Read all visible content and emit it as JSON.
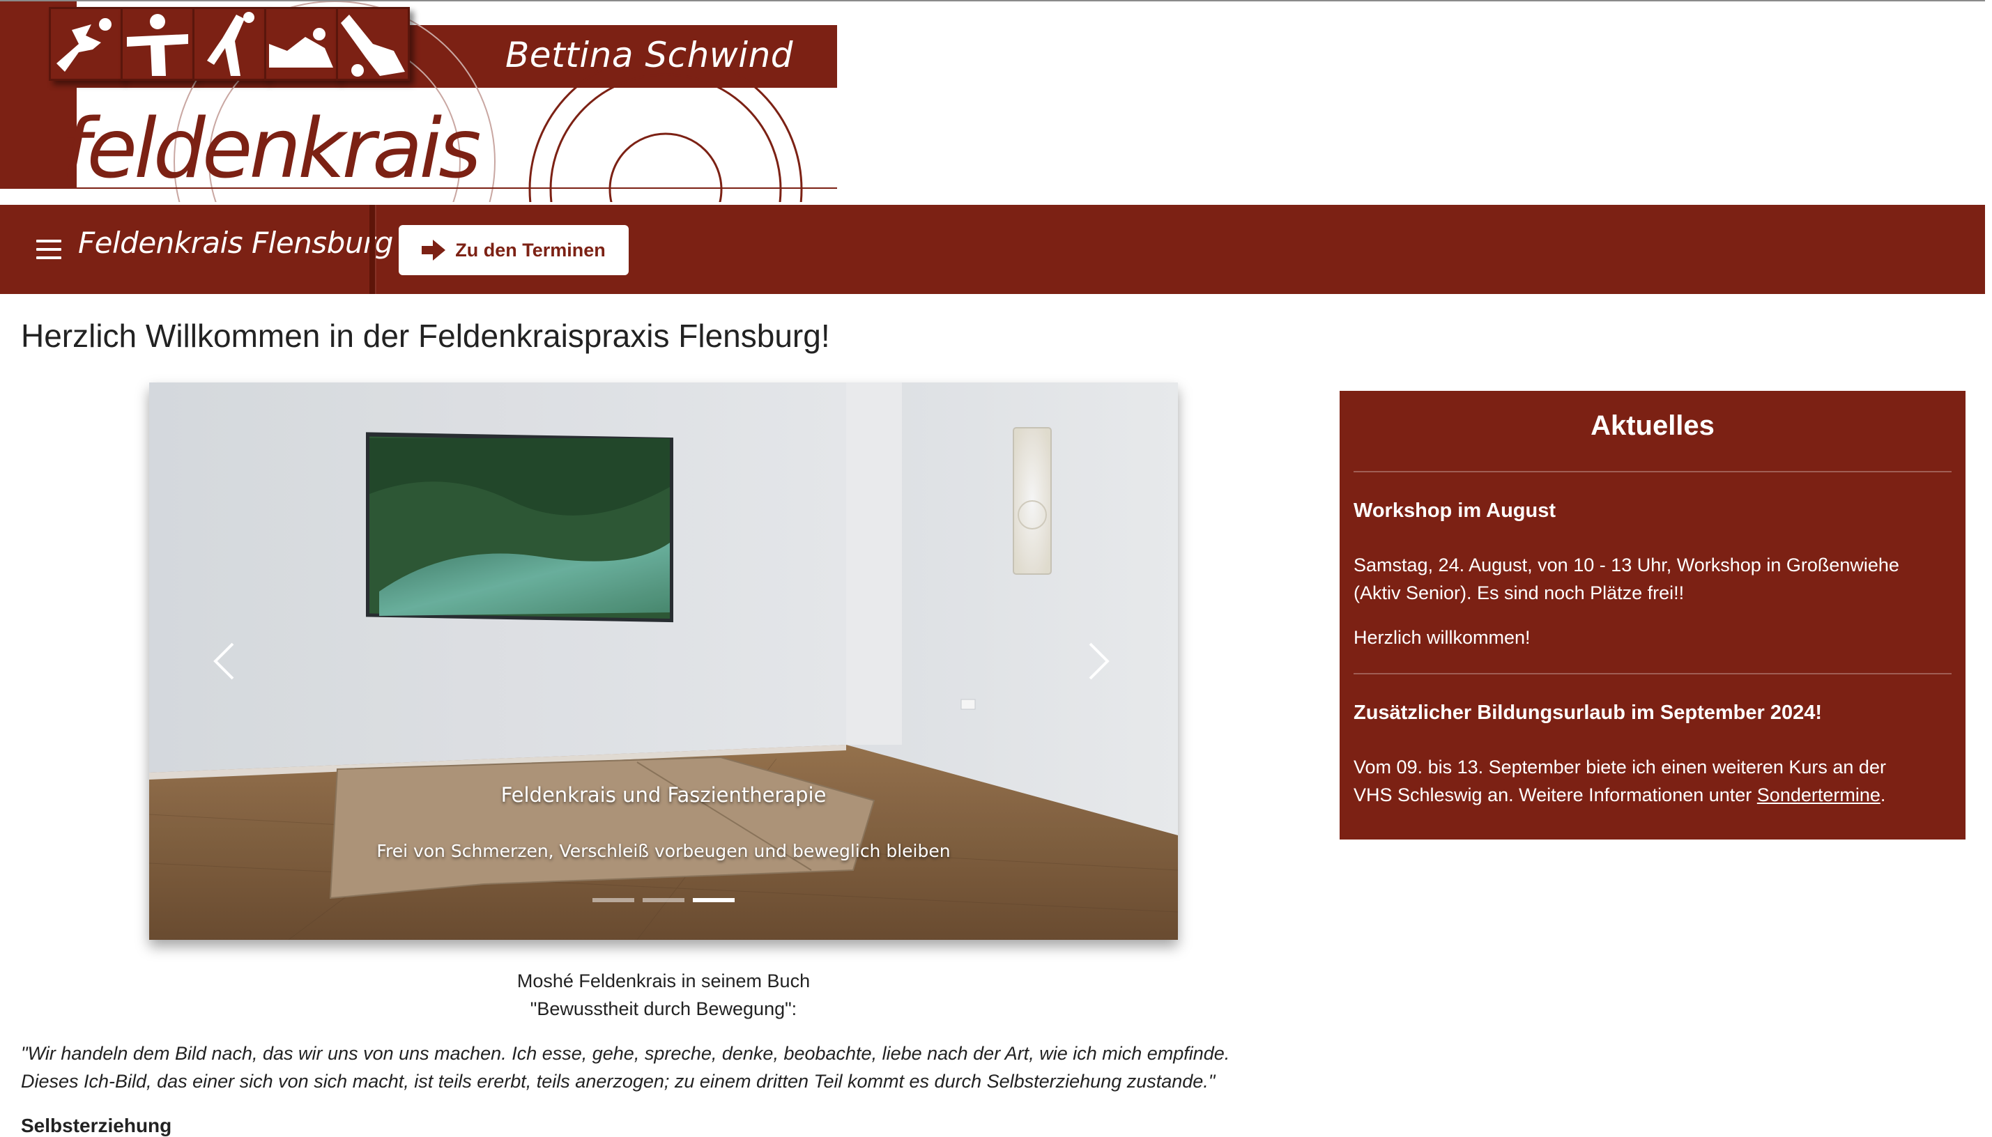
{
  "header": {
    "name": "Bettina Schwind",
    "wordmark": "feldenkrais"
  },
  "navbar": {
    "brand": "Feldenkrais Flensburg",
    "button_label": "Zu den Terminen"
  },
  "main": {
    "title": "Herzlich Willkommen in der Feldenkraispraxis Flensburg!",
    "carousel": {
      "caption_title": "Feldenkrais und Faszientherapie",
      "caption_subtitle": "Frei von Schmerzen, Verschleiß vorbeugen und beweglich bleiben",
      "slide_count": 3,
      "active_slide": 3
    },
    "quote_intro_line1": "Moshé Feldenkrais in seinem Buch",
    "quote_intro_line2": "\"Bewusstheit durch Bewegung\":",
    "quote_line1": "\"Wir handeln dem Bild nach, das wir uns von uns machen. Ich esse, gehe, spreche, denke, beobachte, liebe nach der Art, wie ich mich empfinde.",
    "quote_line2": "Dieses Ich-Bild, das einer sich von sich macht, ist teils ererbt, teils anerzogen; zu einem dritten Teil kommt es durch Selbsterziehung zustande.\"",
    "section_heading": "Selbsterziehung"
  },
  "sidebar": {
    "title": "Aktuelles",
    "items": [
      {
        "heading": "Workshop im August",
        "text1_line1": "Samstag, 24. August, von 10 - 13 Uhr, Workshop in Großenwiehe",
        "text1_line2": "(Aktiv Senior). Es sind noch Plätze frei!!",
        "text2": "Herzlich willkommen!"
      },
      {
        "heading": "Zusätzlicher Bildungsurlaub im September 2024!",
        "text_line1": "Vom 09. bis 13. September biete ich einen weiteren Kurs an der",
        "text_line2_prefix": "VHS Schleswig an. Weitere Informationen unter ",
        "link_label": "Sondertermine",
        "text_line2_suffix": "."
      }
    ]
  },
  "colors": {
    "brand": "#7c2114",
    "text": "#222222",
    "background": "#ffffff"
  },
  "icons": {
    "menu": "hamburger-icon",
    "button": "arrow-right-icon",
    "carousel_prev": "chevron-left-icon",
    "carousel_next": "chevron-right-icon"
  }
}
